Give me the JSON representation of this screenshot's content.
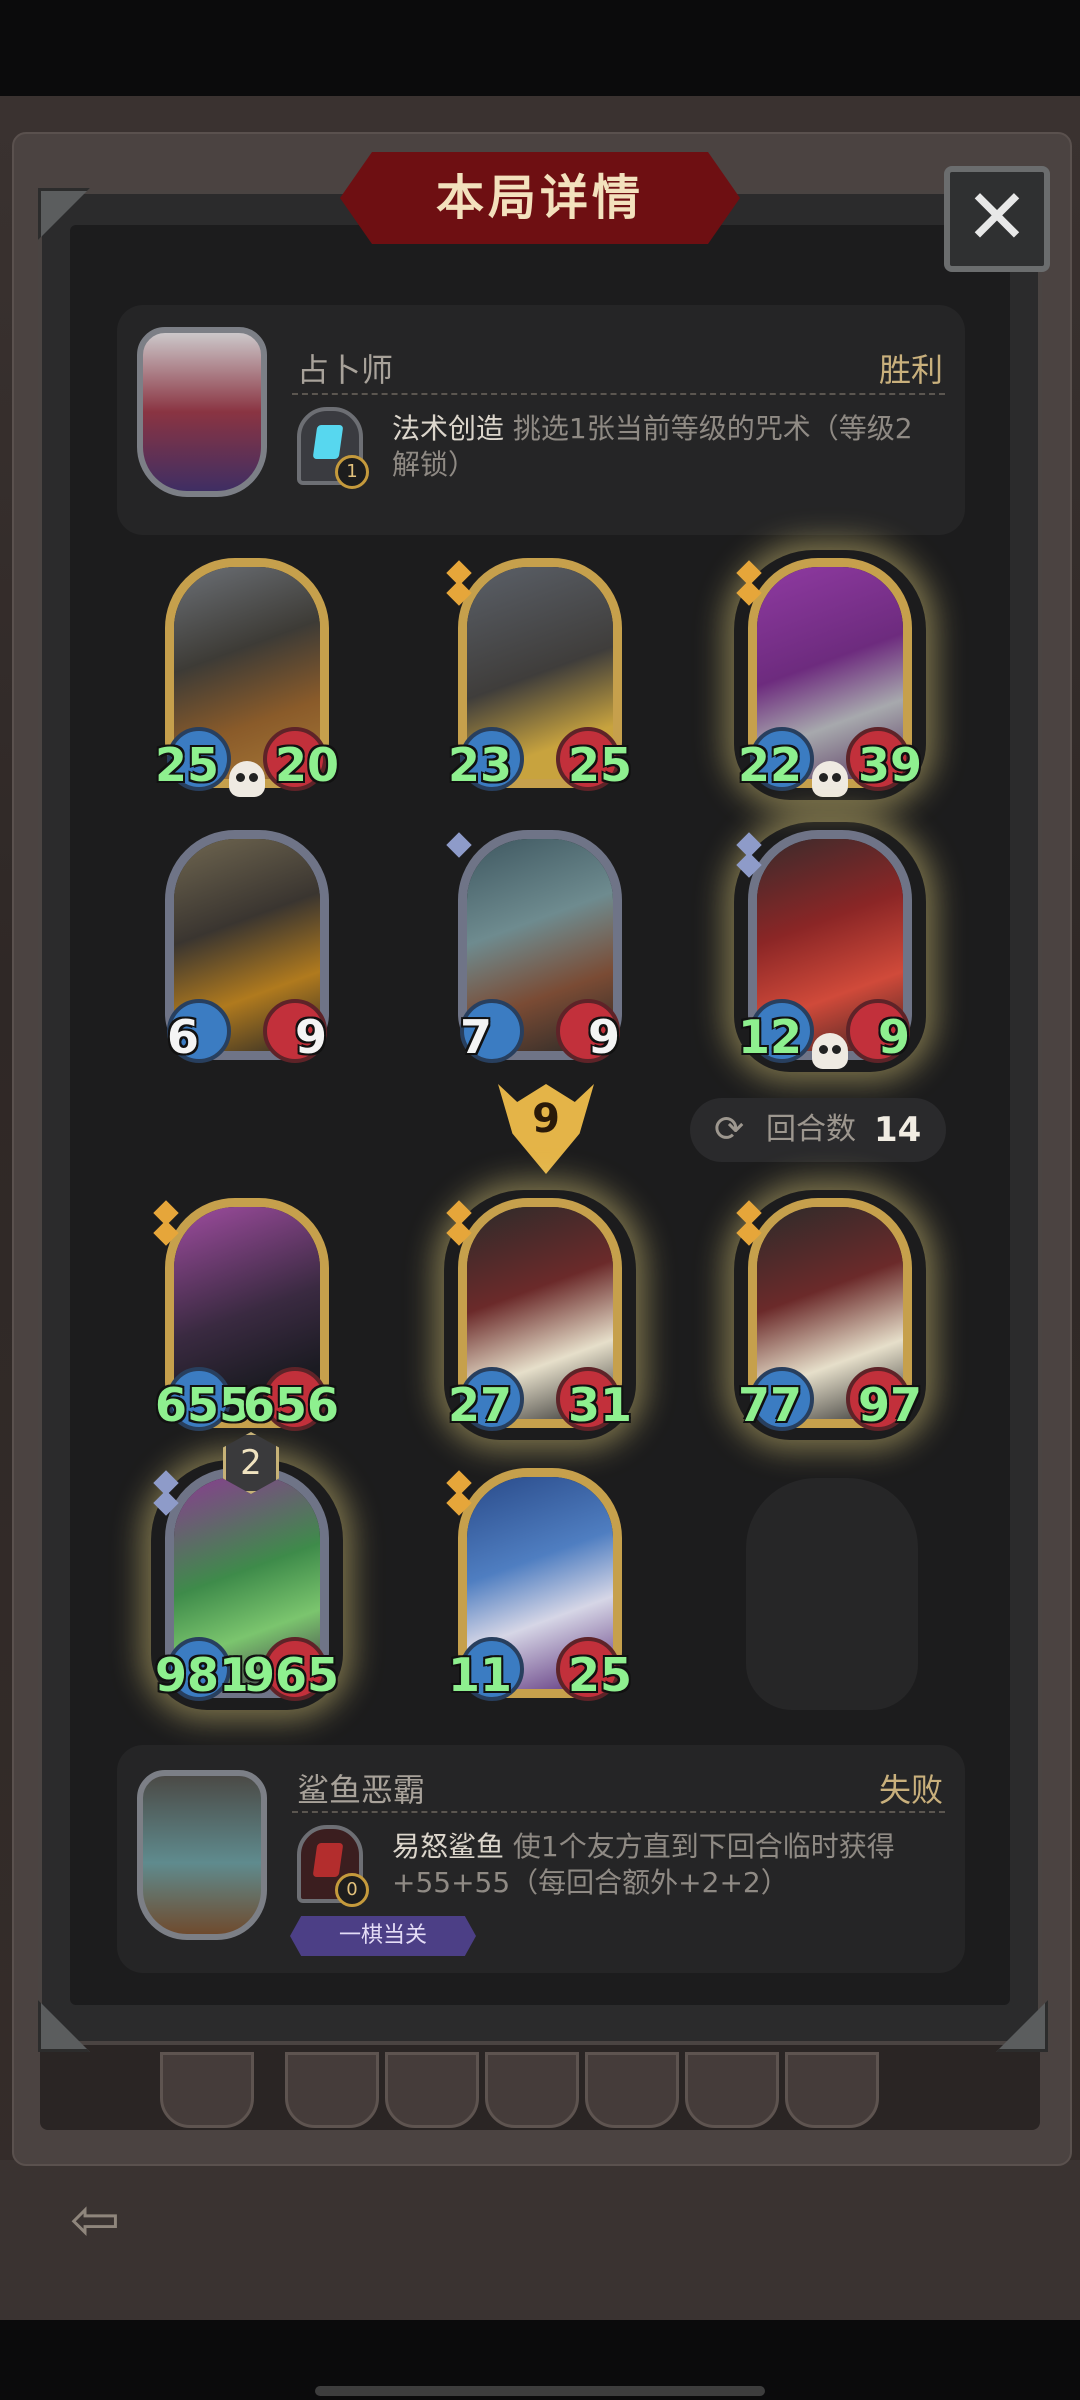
{
  "title": "本局详情",
  "close_icon": "close-icon",
  "back_icon": "back-arrow-icon",
  "player1": {
    "name": "占卜师",
    "result": "胜利",
    "skill_level": "1",
    "skill_name": "法术创造",
    "skill_desc": "挑选1张当前等级的咒术（等级2解锁）"
  },
  "player2": {
    "name": "鲨鱼恶霸",
    "result": "失败",
    "skill_level": "0",
    "skill_name": "易怒鲨鱼",
    "skill_desc": "使1个友方直到下回合临时获得+55+55（每回合额外+2+2）",
    "achievement": "一棋当关"
  },
  "opponent_units": [
    {
      "atk": "25",
      "hp": "20",
      "gold": true,
      "golden": false,
      "skull": true,
      "stars": 0
    },
    {
      "atk": "23",
      "hp": "25",
      "gold": true,
      "golden": false,
      "skull": false,
      "stars": 2
    },
    {
      "atk": "22",
      "hp": "39",
      "gold": true,
      "golden": true,
      "skull": true,
      "stars": 2
    },
    {
      "atk": "6",
      "hp": "9",
      "gold": false,
      "golden": false,
      "skull": false,
      "stars": 0
    },
    {
      "atk": "7",
      "hp": "9",
      "gold": false,
      "golden": false,
      "skull": false,
      "stars": 1
    },
    {
      "atk": "12",
      "hp": "9",
      "gold": false,
      "golden": true,
      "skull": true,
      "stars": 2
    }
  ],
  "turn_badge": "9",
  "rounds": {
    "label": "回合数",
    "value": "14"
  },
  "player_units": [
    {
      "atk": "655",
      "hp": "656",
      "gold": true,
      "golden": false,
      "stars": 2
    },
    {
      "atk": "27",
      "hp": "31",
      "gold": true,
      "golden": true,
      "stars": 2
    },
    {
      "atk": "77",
      "hp": "97",
      "gold": true,
      "golden": true,
      "stars": 2
    },
    {
      "atk": "981",
      "hp": "965",
      "gold": false,
      "golden": true,
      "stars": 2,
      "level": "2"
    },
    {
      "atk": "11",
      "hp": "25",
      "gold": true,
      "golden": false,
      "stars": 2
    }
  ],
  "colors": {
    "accent_gold": "#c6a04c",
    "stat_green": "#8ef08f",
    "title_red": "#6e0f12"
  }
}
